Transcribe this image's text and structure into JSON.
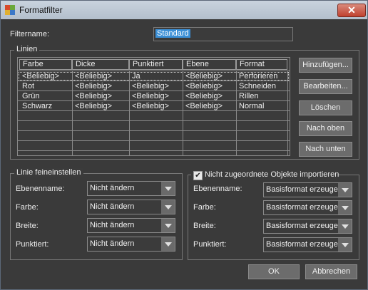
{
  "window": {
    "title": "Formatfilter",
    "close_label": "✕"
  },
  "filtername": {
    "label": "Filtername:",
    "value": "Standard"
  },
  "linien": {
    "group_label": "Linien",
    "columns": [
      "Farbe",
      "Dicke",
      "Punktiert",
      "Ebene",
      "Format"
    ],
    "rows": [
      [
        "<Beliebig>",
        "<Beliebig>",
        "Ja",
        "<Beliebig>",
        "Perforieren"
      ],
      [
        "Rot",
        "<Beliebig>",
        "<Beliebig>",
        "<Beliebig>",
        "Schneiden"
      ],
      [
        "Grün",
        "<Beliebig>",
        "<Beliebig>",
        "<Beliebig>",
        "Rillen"
      ],
      [
        "Schwarz",
        "<Beliebig>",
        "<Beliebig>",
        "<Beliebig>",
        "Normal"
      ]
    ],
    "buttons": {
      "add": "Hinzufügen...",
      "edit": "Bearbeiten...",
      "delete": "Löschen",
      "up": "Nach oben",
      "down": "Nach unten"
    }
  },
  "fine": {
    "group_label": "Linie feineinstellen",
    "ebenenname_label": "Ebenenname:",
    "ebenenname_value": "Nicht ändern",
    "farbe_label": "Farbe:",
    "farbe_value": "Nicht ändern",
    "breite_label": "Breite:",
    "breite_value": "Nicht ändern",
    "punktiert_label": "Punktiert:",
    "punktiert_value": "Nicht ändern"
  },
  "unassigned": {
    "checkbox_label": "Nicht zugeordnete Objekte importieren",
    "checked": true,
    "ebenenname_label": "Ebenenname:",
    "ebenenname_value": "Basisformat erzeugen",
    "farbe_label": "Farbe:",
    "farbe_value": "Basisformat erzeugen",
    "breite_label": "Breite:",
    "breite_value": "Basisformat erzeugen",
    "punktiert_label": "Punktiert:",
    "punktiert_value": "Basisformat erzeugen"
  },
  "footer": {
    "ok": "OK",
    "cancel": "Abbrechen"
  }
}
